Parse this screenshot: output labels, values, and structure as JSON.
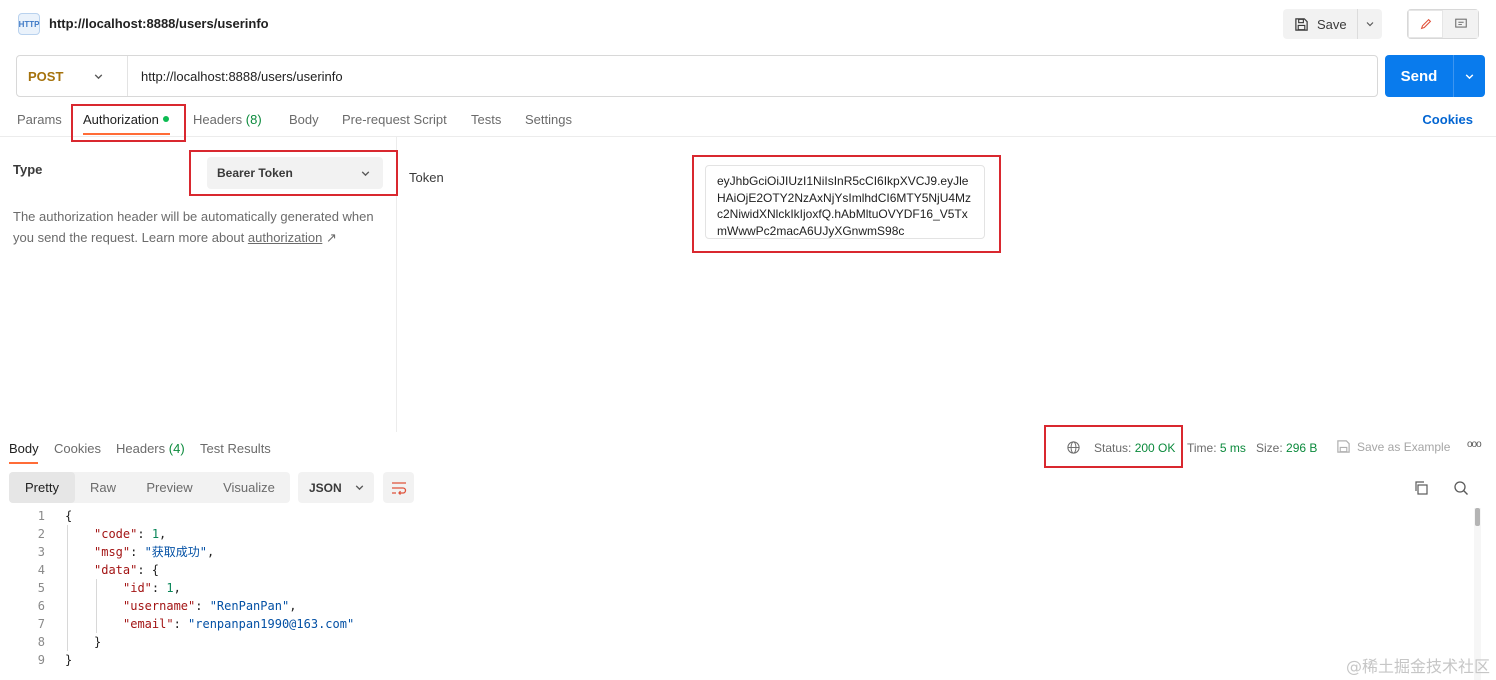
{
  "header": {
    "icon_text": "HTTP",
    "title": "http://localhost:8888/users/userinfo",
    "save_label": "Save"
  },
  "request": {
    "method": "POST",
    "url": "http://localhost:8888/users/userinfo",
    "send_label": "Send"
  },
  "tabs": {
    "params": "Params",
    "authorization": "Authorization",
    "headers": "Headers",
    "headers_count": "(8)",
    "body": "Body",
    "prerequest": "Pre-request Script",
    "tests": "Tests",
    "settings": "Settings",
    "cookies": "Cookies"
  },
  "auth": {
    "type_label": "Type",
    "type_value": "Bearer Token",
    "desc_text": "The authorization header will be automatically generated when you send the request. Learn more about",
    "desc_link": "authorization",
    "desc_arrow": "↗",
    "token_label": "Token",
    "token_value": "eyJhbGciOiJIUzI1NiIsInR5cCI6IkpXVCJ9.eyJleHAiOjE2OTY2NzAxNjYsImlhdCI6MTY5NjU4Mzc2NiwidXNlckIkIjoxfQ.hAbMltuOVYDF16_V5TxmWwwPc2macA6UJyXGnwmS98c"
  },
  "response": {
    "tabs": {
      "body": "Body",
      "cookies": "Cookies",
      "headers": "Headers",
      "headers_count": "(4)",
      "test_results": "Test Results"
    },
    "status_label": "Status:",
    "status_value": "200 OK",
    "time_label": "Time:",
    "time_value": "5 ms",
    "size_label": "Size:",
    "size_value": "296 B",
    "save_example": "Save as Example",
    "more": "ooo",
    "views": [
      "Pretty",
      "Raw",
      "Preview",
      "Visualize"
    ],
    "format": "JSON"
  },
  "code": {
    "line_numbers": [
      "1",
      "2",
      "3",
      "4",
      "5",
      "6",
      "7",
      "8",
      "9"
    ],
    "open_brace": "{",
    "code_key": "\"code\"",
    "code_val": "1",
    "msg_key": "\"msg\"",
    "msg_val": "\"获取成功\"",
    "data_key": "\"data\"",
    "id_key": "\"id\"",
    "id_val": "1",
    "username_key": "\"username\"",
    "username_val": "\"RenPanPan\"",
    "email_key": "\"email\"",
    "email_val": "\"renpanpan1990@163.com\"",
    "inner_close": "}",
    "close_brace": "}"
  },
  "watermark": "@稀土掘金技术社区",
  "colors": {
    "accent": "#ff6c37",
    "primary": "#097bed",
    "annotation": "#d9282f",
    "success": "#0b8a3c"
  }
}
